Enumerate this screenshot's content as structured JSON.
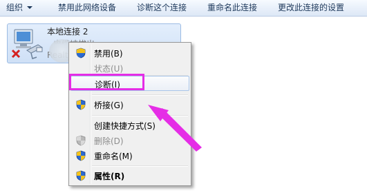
{
  "toolbar": {
    "organize": "组织",
    "disable_device": "禁用此网络设备",
    "diagnose_connection": "诊断这个连接",
    "rename_connection": "重命名此连接",
    "change_settings": "更改此连接的设置"
  },
  "connection": {
    "name": "本地连接 2",
    "status": "电缆被拔出",
    "adapter": "Realtek"
  },
  "context_menu": {
    "disable": "禁用(B)",
    "status": "状态(U)",
    "diagnose": "诊断(I)",
    "bridge": "桥接(G)",
    "create_shortcut": "创建快捷方式(S)",
    "delete": "删除(D)",
    "rename": "重命名(M)",
    "properties": "属性(R)"
  },
  "colors": {
    "annotation": "#e52de6",
    "toolbar_text": "#1e395b"
  }
}
